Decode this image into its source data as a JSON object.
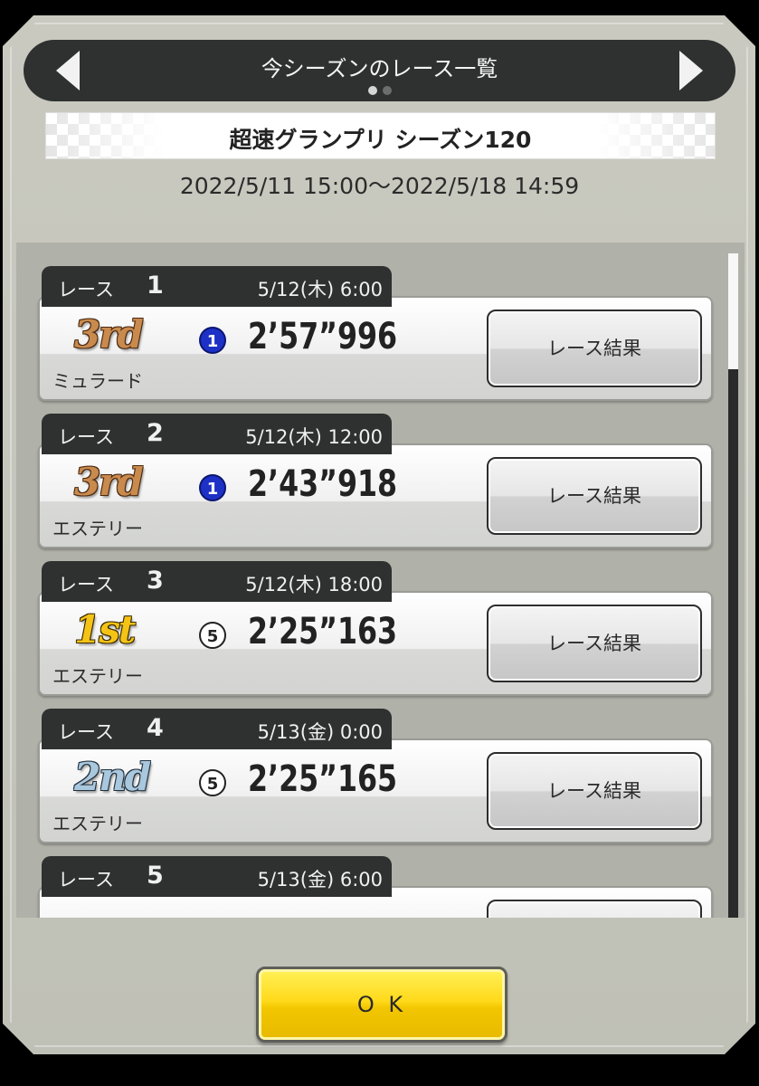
{
  "header": {
    "title": "今シーズンのレース一覧",
    "page_indicator": {
      "current": 1,
      "total": 2
    }
  },
  "season": {
    "name": "超速グランプリ シーズン120",
    "period": "2022/5/11 15:00〜2022/5/18 14:59"
  },
  "races": [
    {
      "label": "レース",
      "number": "1",
      "datetime": "5/12(木) 6:00",
      "place": "3rd",
      "gate": "1",
      "time": "2’57”996",
      "horse": "ミュラード",
      "button": "レース結果"
    },
    {
      "label": "レース",
      "number": "2",
      "datetime": "5/12(木) 12:00",
      "place": "3rd",
      "gate": "1",
      "time": "2’43”918",
      "horse": "エステリー",
      "button": "レース結果"
    },
    {
      "label": "レース",
      "number": "3",
      "datetime": "5/12(木) 18:00",
      "place": "1st",
      "gate": "5",
      "time": "2’25”163",
      "horse": "エステリー",
      "button": "レース結果"
    },
    {
      "label": "レース",
      "number": "4",
      "datetime": "5/13(金) 0:00",
      "place": "2nd",
      "gate": "5",
      "time": "2’25”165",
      "horse": "エステリー",
      "button": "レース結果"
    },
    {
      "label": "レース",
      "number": "5",
      "datetime": "5/13(金) 6:00"
    }
  ],
  "footer": {
    "ok_label": "O K"
  },
  "colors": {
    "gate_1": "#1d31c6",
    "place_1st": "#f5c316",
    "place_2nd": "#a9c7dd",
    "place_3rd": "#c98a4e",
    "ok_button": "#ffd91a"
  }
}
